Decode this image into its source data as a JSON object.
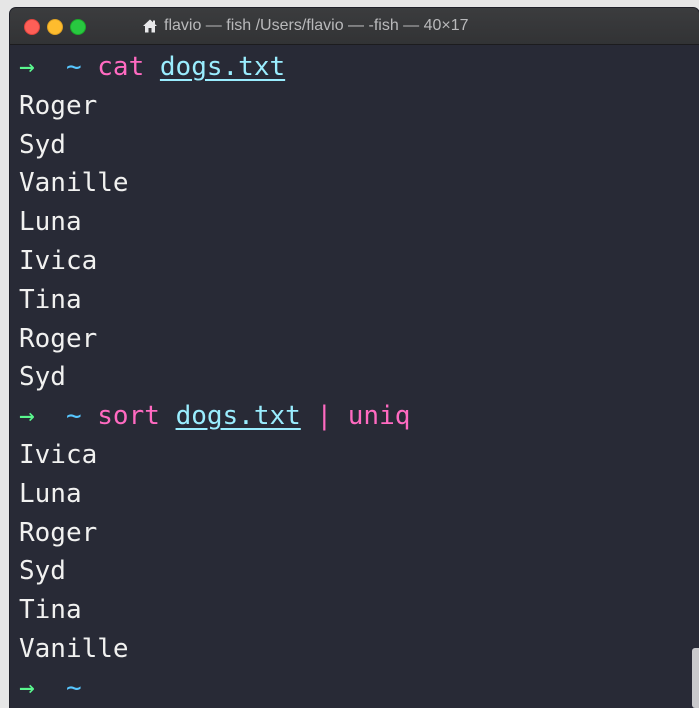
{
  "window": {
    "title": "flavio — fish /Users/flavio — -fish — 40×17",
    "icon": "home-icon"
  },
  "colors": {
    "background": "#282a36",
    "prompt_arrow": "#5af78e",
    "prompt_tilde": "#57c7ff",
    "command": "#ff6ac1",
    "argument": "#9aedfe",
    "output": "#f1f1f0"
  },
  "session": {
    "prompt_arrow": "→",
    "prompt_tilde": "~",
    "command1": {
      "cmd": "cat",
      "arg": "dogs.txt",
      "output": [
        "Roger",
        "Syd",
        "Vanille",
        "Luna",
        "Ivica",
        "Tina",
        "Roger",
        "Syd"
      ]
    },
    "command2": {
      "cmd": "sort",
      "arg": "dogs.txt",
      "pipe": "|",
      "cmd2": "uniq",
      "output": [
        "Ivica",
        "Luna",
        "Roger",
        "Syd",
        "Tina",
        "Vanille"
      ]
    }
  }
}
